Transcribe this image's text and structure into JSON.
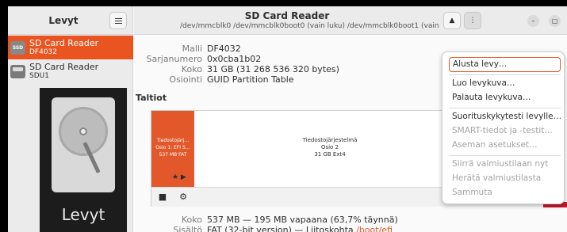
{
  "sidebar": {
    "title": "Levyt",
    "items": [
      {
        "name": "SD Card Reader",
        "sub": "DF4032",
        "icon": "ssd-icon",
        "icon_text": "SSD",
        "selected": true
      },
      {
        "name": "SD Card Reader",
        "sub": "SDU1",
        "icon": "sd-card-icon",
        "selected": false
      }
    ],
    "splash_label": "Levyt"
  },
  "header": {
    "title": "SD Card Reader",
    "subtitle": "/dev/mmcblk0 /dev/mmcblk0boot0 (vain luku) /dev/mmcblk0boot1 (vain lu",
    "eject_icon": "▲",
    "menu_icon": "⋮",
    "minimize_icon": "–",
    "maximize_icon": "▢"
  },
  "drive": {
    "model_label": "Malli",
    "model": "DF4032",
    "serial_label": "Sarjanumero",
    "serial": "0x0cba1b02",
    "size_label": "Koko",
    "size": "31 GB (31 268 536 320 bytes)",
    "partitioning_label": "Osiointi",
    "partitioning": "GUID Partition Table"
  },
  "volumes": {
    "section_title": "Taltiot",
    "efi": {
      "line1": "Tiedostojärj…",
      "line2": "Osio 1: EFI S…",
      "line3": "537 MB FAT"
    },
    "main": {
      "line1": "Tiedostojärjestelmä",
      "line2": "Osio 2",
      "line3": "31 GB Ext4"
    },
    "efi_marks": "★ ▶",
    "stop_icon": "■",
    "gear_icon": "⚙"
  },
  "selected_volume": {
    "size_label": "Koko",
    "size": "537 MB — 195 MB vapaana (63,7% täynnä)",
    "contents_label": "Sisältö",
    "contents_prefix": "FAT (32-bit version) — Liitoskohta ",
    "mount_point": "/boot/efi"
  },
  "menu": {
    "items": [
      {
        "label": "Alusta levy…",
        "enabled": true
      },
      {
        "label": "Luo levykuva…",
        "enabled": true
      },
      {
        "label": "Palauta levykuva…",
        "enabled": true
      },
      {
        "label": "Suorituskykytesti levylle…",
        "enabled": true
      },
      {
        "label": "SMART-tiedot ja -testit…",
        "enabled": false
      },
      {
        "label": "Aseman asetukset…",
        "enabled": false
      },
      {
        "label": "Siirrä valmiustilaan nyt",
        "enabled": false
      },
      {
        "label": "Herätä valmiustilasta",
        "enabled": false
      },
      {
        "label": "Sammuta",
        "enabled": false
      }
    ]
  },
  "colors": {
    "accent": "#e95420",
    "selection": "#e95420",
    "danger": "#c7162b"
  }
}
